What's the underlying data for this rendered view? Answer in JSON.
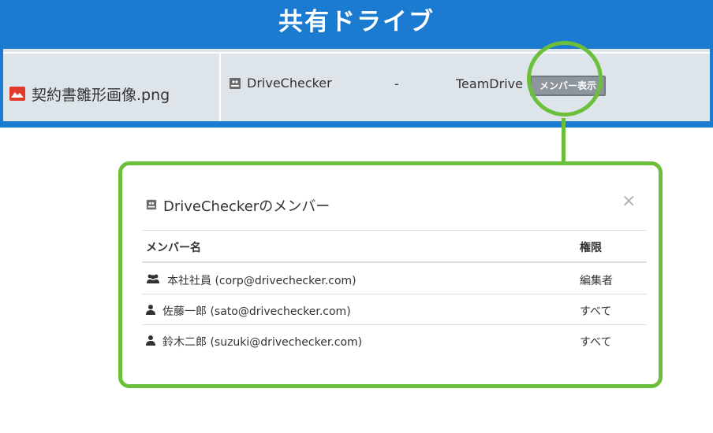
{
  "banner": {
    "title": "共有ドライブ"
  },
  "file_row": {
    "file_name": "契約書雛形画像.png",
    "drive_name": "DriveChecker",
    "dash": "-",
    "drive_type": "TeamDrive",
    "member_button": "メンバー表示"
  },
  "modal": {
    "title": "DriveCheckerのメンバー",
    "close": "×",
    "headers": {
      "member": "メンバー名",
      "permission": "権限"
    },
    "members": [
      {
        "name": "本社社員 (corp@drivechecker.com)",
        "permission": "編集者",
        "icon": "group-icon"
      },
      {
        "name": "佐藤一郎 (sato@drivechecker.com)",
        "permission": "すべて",
        "icon": "user-icon"
      },
      {
        "name": "鈴木二郎 (suzuki@drivechecker.com)",
        "permission": "すべて",
        "icon": "user-icon"
      }
    ]
  },
  "colors": {
    "banner": "#1a7bd0",
    "highlight": "#6cbf3b",
    "file_icon": "#e13a2b"
  }
}
